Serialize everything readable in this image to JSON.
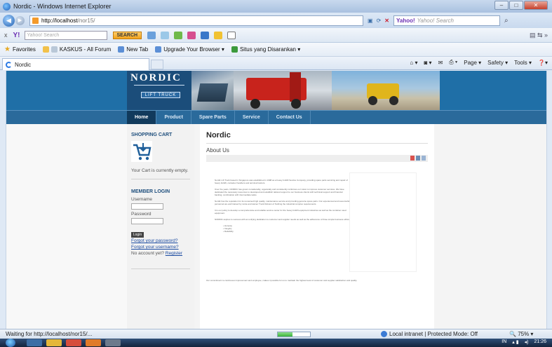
{
  "window": {
    "title": "Nordic - Windows Internet Explorer",
    "minimize": "–",
    "maximize": "□",
    "close": "✕"
  },
  "addressbar": {
    "back_glyph": "◀",
    "forward_glyph": "▶",
    "url_host": "http://localhost",
    "url_path": "/nor15/",
    "search_engine_label": "Yahoo!",
    "search_placeholder": "Yahoo! Search",
    "search_glyph": "⌕"
  },
  "yahoo_toolbar": {
    "close": "x",
    "logo": "Y!",
    "search_placeholder": "Yahoo! Search",
    "search_button": "SEARCH"
  },
  "favorites_bar": {
    "favorites": "Favorites",
    "items": [
      "KASKUS - All Forum",
      "New Tab",
      "Upgrade Your Browser ▾",
      "Situs yang Disarankan ▾"
    ]
  },
  "tab": {
    "label": "Nordic"
  },
  "commandbar": {
    "items": [
      "Page ▾",
      "Safety ▾",
      "Tools ▾"
    ]
  },
  "site": {
    "logo_name": "NORDIC",
    "logo_sub": "LIFT TRUCK",
    "nav": [
      {
        "label": "Home",
        "active": true
      },
      {
        "label": "Product",
        "active": false
      },
      {
        "label": "Spare Parts",
        "active": false
      },
      {
        "label": "Service",
        "active": false
      },
      {
        "label": "Contact Us",
        "active": false
      }
    ]
  },
  "sidebar": {
    "cart_title": "SHOPPING CART",
    "cart_empty": "Your Cart is currently empty.",
    "login_title": "MEMBER LOGIN",
    "username_label": "Username",
    "password_label": "Password",
    "login_button": "Login",
    "forgot_password": "Forgot your password?",
    "forgot_username": "Forgot your username?",
    "no_account": "No account yet?",
    "register": "Register"
  },
  "content": {
    "title": "Nordic",
    "subtitle": "About Us",
    "paragraphs": [
      "Nordic Lift Truck based in Singapore was established in 1998 as a heavy forklift Service Company, providing spare parts servicing and repair of heavy forklift, container handlers and terminal tractors.",
      "Over the years, NORDIC has grown considerably, organically and consistently reinforces our vision to improve customer services. We have dedicated the necessary resources to developed and establish tailored support to our business clients with technical support and financial backing, combination with intermediate tasks.",
      "Nordic has the reputation for its renowned high quality, maintenance service and providing genuine spare parts. Our experienced and resourceful personnel are well trained by Linde and Hamer Truck Division of Nothing the industrial complex requirements.",
      "It is our policy to develop a comprehensive and reliable service center for the heavy forklift equipment industries as well as the container used equipment.",
      "NORDIC aspires to success with an unifying dedication to customer and supplier needs as well as the adherence of three simple business ethics:"
    ],
    "ethics": [
      "Honesty",
      "Integrity",
      "Reliability"
    ],
    "closing": "Our commitment to continuous improvement and employee, makes it possible for us to maintain the highest level of customer and supplier satisfaction and quality."
  },
  "statusbar": {
    "message": "Waiting for http://localhost/nor15/...",
    "progress": 0.45,
    "zone": "Local intranet | Protected Mode: Off",
    "zoom": "75%"
  },
  "taskbar": {
    "tray_lang": "IN",
    "clock": "21:26"
  },
  "colors": {
    "header_blue": "#1f6fa7",
    "nav_blue": "#2a6a9b",
    "active_tab": "#113a5c"
  }
}
